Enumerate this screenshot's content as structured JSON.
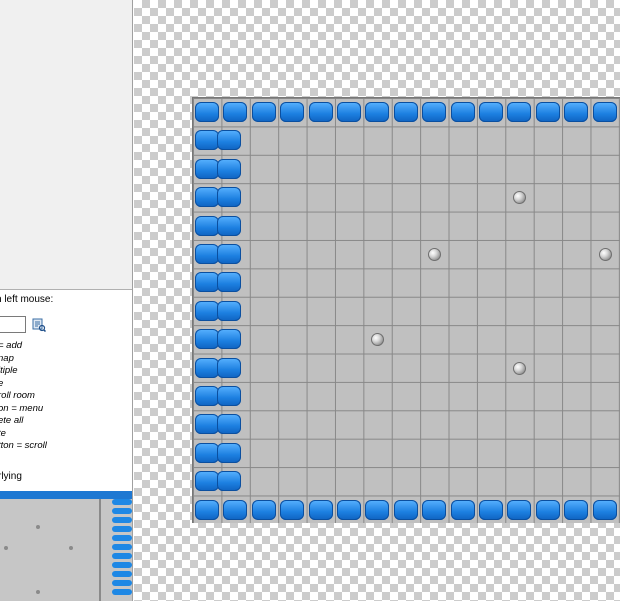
{
  "info_panel": {
    "heading": "n left mouse:",
    "instructions": [
      " = add",
      "nap",
      "ltiple",
      "e",
      "roll room",
      "on = menu",
      "ete all",
      "te",
      "tton = scroll"
    ],
    "footer": "rlying"
  },
  "icons": {
    "field_icon": "list-search-icon",
    "tile": "blue-block-tile",
    "ball": "silver-ball"
  },
  "colors": {
    "tile_blue": "#1e88e5",
    "grid_bg": "#c0c0c0",
    "grid_line": "#888888",
    "checker_dark": "#cccccc",
    "checker_light": "#ffffff"
  },
  "editor": {
    "balls": [
      {
        "col": 11,
        "row": 3
      },
      {
        "col": 8,
        "row": 5
      },
      {
        "col": 14,
        "row": 5
      },
      {
        "col": 6,
        "row": 8
      },
      {
        "col": 11,
        "row": 9
      }
    ]
  }
}
